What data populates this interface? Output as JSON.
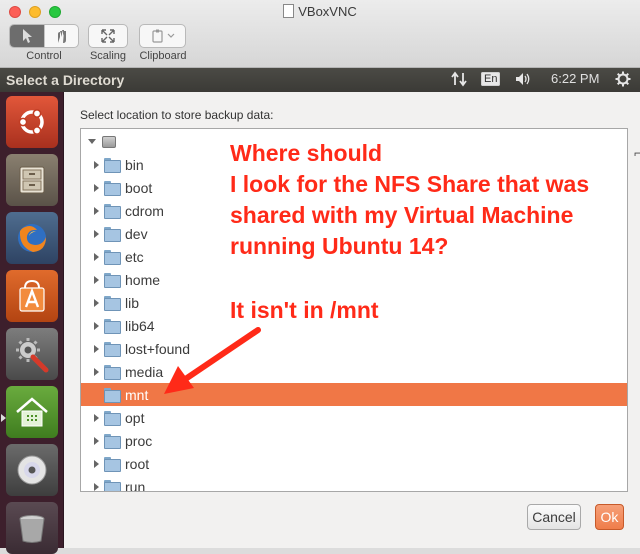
{
  "window": {
    "title": "VBoxVNC",
    "toolbar": {
      "control_label": "Control",
      "scaling_label": "Scaling",
      "clipboard_label": "Clipboard"
    }
  },
  "panel": {
    "app_title": "Select a Directory",
    "keyboard_layout": "En",
    "time": "6:22 PM"
  },
  "launcher": {
    "items": [
      "ubuntu-dash-icon",
      "file-cabinet-icon",
      "firefox-icon",
      "software-center-icon",
      "system-settings-icon",
      "home-folder-icon",
      "dvd-icon",
      "trash-icon"
    ]
  },
  "dialog": {
    "prompt": "Select location to store backup data:",
    "tree": [
      {
        "label": "",
        "type": "drive",
        "expanded": true
      },
      {
        "label": "bin"
      },
      {
        "label": "boot"
      },
      {
        "label": "cdrom"
      },
      {
        "label": "dev"
      },
      {
        "label": "etc"
      },
      {
        "label": "home"
      },
      {
        "label": "lib"
      },
      {
        "label": "lib64"
      },
      {
        "label": "lost+found"
      },
      {
        "label": "media"
      },
      {
        "label": "mnt",
        "selected": true
      },
      {
        "label": "opt"
      },
      {
        "label": "proc"
      },
      {
        "label": "root"
      },
      {
        "label": "run"
      }
    ],
    "cancel_label": "Cancel",
    "ok_label": "Ok"
  },
  "annotation": {
    "lines": [
      "Where should",
      "I look for the NFS Share that was",
      "shared with my Virtual Machine",
      "running Ubuntu 14?"
    ],
    "note": "It isn't in /mnt"
  },
  "colors": {
    "selection": "#f07746",
    "annotation": "#ff2a18",
    "launcher": "#3d1f2c",
    "panel": "#3b3a36"
  }
}
